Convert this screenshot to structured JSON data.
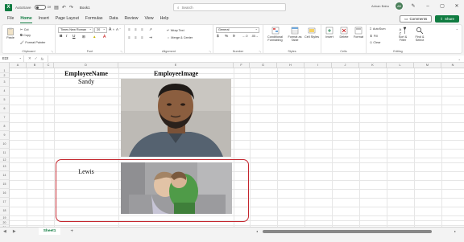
{
  "titlebar": {
    "autosave_label": "AutoSave",
    "toggle_state": "Off",
    "doc_name": "Book1",
    "search_placeholder": "Search",
    "user_name": "Adnan Babu",
    "user_initials": "AB"
  },
  "menu": {
    "tabs": [
      "File",
      "Home",
      "Insert",
      "Page Layout",
      "Formulas",
      "Data",
      "Review",
      "View",
      "Help"
    ],
    "active": "Home",
    "comments_label": "Comments",
    "share_label": "Share"
  },
  "ribbon": {
    "clipboard": {
      "paste": "Paste",
      "cut": "Cut",
      "copy": "Copy",
      "format_painter": "Format Painter",
      "label": "Clipboard"
    },
    "font": {
      "name": "Times New Roman",
      "size": "20",
      "label": "Font",
      "bold": "B",
      "italic": "I",
      "underline": "U"
    },
    "alignment": {
      "wrap": "Wrap Text",
      "merge": "Merge & Center",
      "label": "Alignment"
    },
    "number": {
      "format": "General",
      "currency": "$",
      "percent": "%",
      "comma": "9",
      "label": "Number"
    },
    "styles": {
      "conditional": "Conditional Formatting",
      "table": "Format as Table",
      "cell": "Cell Styles",
      "label": "Styles"
    },
    "cells": {
      "insert": "Insert",
      "delete": "Delete",
      "format": "Format",
      "label": "Cells"
    },
    "editing": {
      "autosum": "AutoSum",
      "fill": "Fill",
      "clear": "Clear",
      "sort": "Sort & Filter",
      "find": "Find & Select",
      "label": "Editing"
    }
  },
  "formula_bar": {
    "name_box": "E22",
    "fx": "fx"
  },
  "grid": {
    "columns": [
      "A",
      "B",
      "C",
      "D",
      "E",
      "F",
      "G",
      "H",
      "I",
      "J",
      "K",
      "L",
      "M",
      "N"
    ],
    "rows": [
      "1",
      "2",
      "3",
      "4",
      "5",
      "6",
      "7",
      "8",
      "9",
      "10",
      "11",
      "12",
      "13",
      "14",
      "15",
      "16",
      "17",
      "18",
      "19",
      "20",
      "21"
    ],
    "header_name": "EmployeeName",
    "header_image": "EmployeeImage",
    "employee_1": "Sandy",
    "employee_2": "Lewis"
  },
  "sheets": {
    "active": "Sheet1",
    "add": "+"
  }
}
